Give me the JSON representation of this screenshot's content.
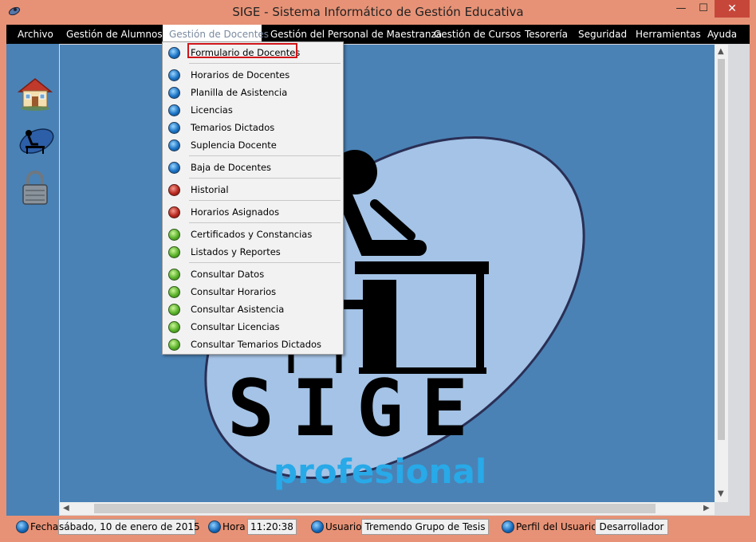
{
  "window": {
    "title": "SIGE - Sistema Informático de Gestión Educativa",
    "min": "—",
    "max": "☐",
    "close": "✕"
  },
  "menubar": {
    "items": [
      "Archivo",
      "Gestión de  Alumnos",
      "Gestión de Docentes",
      "Gestión del Personal de Maestranza",
      "Gestión de Cursos",
      "Tesorería",
      "Seguridad",
      "Herramientas",
      "Ayuda"
    ],
    "active_index": 2
  },
  "toolbar": {
    "icons": [
      "home-icon",
      "teacher-desk-icon",
      "padlock-icon"
    ]
  },
  "dropdown": {
    "items": [
      {
        "label": "Formulario de Docentes",
        "dot": "blue"
      },
      {
        "label": "Horarios de Docentes",
        "dot": "blue"
      },
      {
        "label": "Planilla de Asistencia",
        "dot": "blue"
      },
      {
        "label": "Licencias",
        "dot": "blue"
      },
      {
        "label": "Temarios Dictados",
        "dot": "blue"
      },
      {
        "label": "Suplencia Docente",
        "dot": "blue"
      },
      {
        "label": "Baja de Docentes",
        "dot": "blue"
      },
      {
        "label": "Historial",
        "dot": "red"
      },
      {
        "label": "Horarios Asignados",
        "dot": "red"
      },
      {
        "label": "Certificados y Constancias",
        "dot": "green"
      },
      {
        "label": "Listados y Reportes",
        "dot": "green"
      },
      {
        "label": "Consultar Datos",
        "dot": "green"
      },
      {
        "label": "Consultar Horarios",
        "dot": "green"
      },
      {
        "label": "Consultar Asistencia",
        "dot": "green"
      },
      {
        "label": "Consultar Licencias",
        "dot": "green"
      },
      {
        "label": "Consultar Temarios Dictados",
        "dot": "green"
      }
    ],
    "highlighted": "Formulario de Docentes"
  },
  "logo": {
    "main": "SIGE",
    "sub": "profesional"
  },
  "statusbar": {
    "fecha_label": "Fecha",
    "fecha_value": "sábado, 10 de enero de 2015",
    "hora_label": "Hora",
    "hora_value": "11:20:38",
    "usuario_label": "Usuario",
    "usuario_value": "Tremendo Grupo de Tesis",
    "perfil_label": "Perfil del Usuario",
    "perfil_value": "Desarrollador"
  },
  "colors": {
    "titlebar": "#e79276",
    "menubar": "#000000",
    "canvas": "#4a82b5",
    "close": "#c7463a",
    "highlight": "#d0151a"
  }
}
